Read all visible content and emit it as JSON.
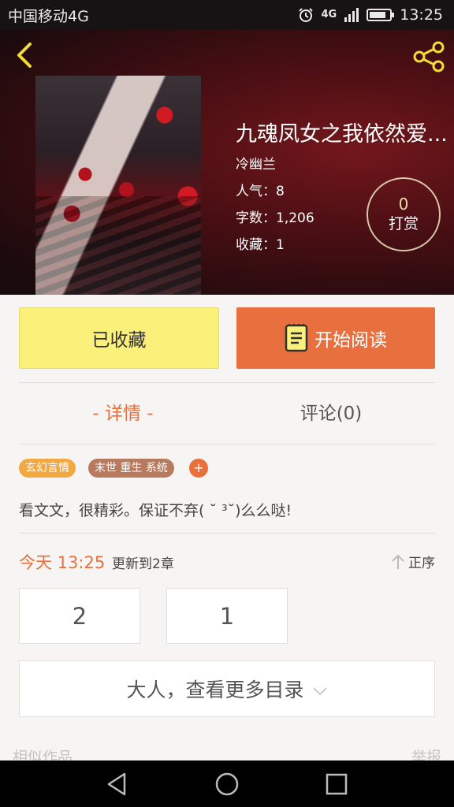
{
  "status_bar": {
    "carrier": "中国移动4G",
    "network": "4G",
    "time": "13:25"
  },
  "book": {
    "title": "九魂凤女之我依然爱...",
    "author": "冷幽兰",
    "popularity": "人气：8",
    "word_count": "字数：1,206",
    "favorites": "收藏：1",
    "tip_count": "0",
    "tip_label": "打赏"
  },
  "actions": {
    "favorited_label": "已收藏",
    "start_reading_label": "开始阅读"
  },
  "tabs": {
    "details": "- 详情 -",
    "comments": "评论(0)"
  },
  "tags": [
    "玄幻言情",
    "末世 重生 系统"
  ],
  "tag_add": "+",
  "description": "看文文，很精彩。保证不弃( ˘ ³˘)么么哒!",
  "update": {
    "time": "今天 13:25",
    "text": "更新到2章",
    "sort_label": "正序"
  },
  "chapters": [
    "2",
    "1"
  ],
  "more_catalog": "大人，查看更多目录",
  "footer": {
    "similar": "相似作品",
    "report": "举报"
  },
  "colors": {
    "accent": "#e8703e",
    "favorite_button": "#fbf07a",
    "tag_primary": "#f3a942",
    "tag_secondary": "#b87a5e"
  }
}
